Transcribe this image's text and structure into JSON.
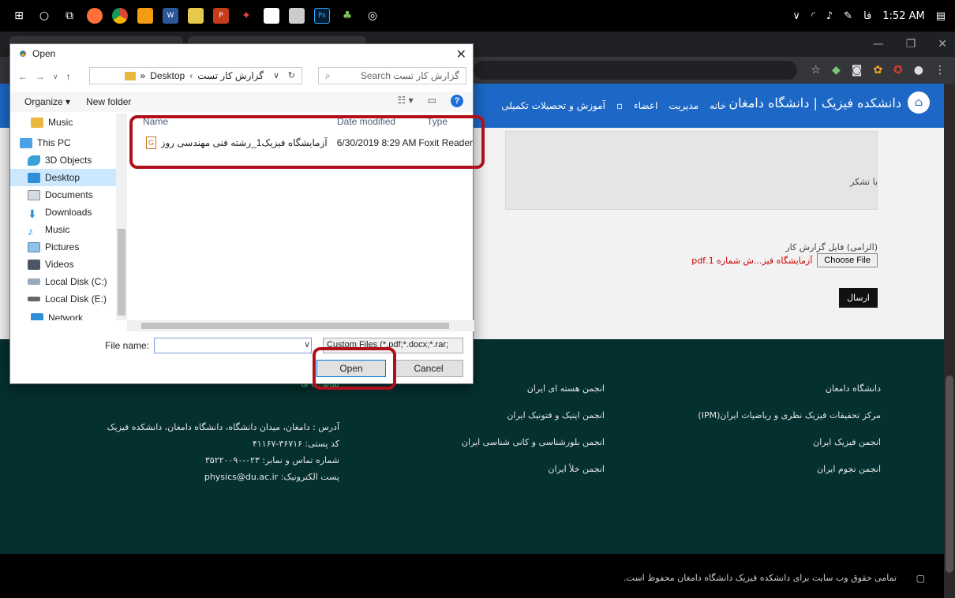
{
  "taskbar": {
    "apps": [
      "windows-icon",
      "search-icon",
      "task-view-icon",
      "firefox-icon",
      "chrome-icon",
      "edge-icon",
      "word-icon",
      "notepad-icon",
      "powerpoint-icon",
      "app-icon",
      "note-icon",
      "calculator-icon",
      "photoshop-icon",
      "leaf-icon",
      "settings-icon"
    ],
    "lang": "فا",
    "time": "1:52 AM"
  },
  "dialog": {
    "title": "Open",
    "path_root": "Desktop",
    "path_prefix": "«",
    "path_folder": "گزارش کار تست",
    "search_placeholder": "گزارش کار تست Search",
    "organize": "Organize ▾",
    "new_folder": "New folder",
    "nav_items": [
      {
        "label": "Music",
        "icon": "music-folder-icon"
      },
      {
        "label": "This PC",
        "icon": "pc-icon"
      },
      {
        "label": "3D Objects",
        "icon": "3d-objects-icon"
      },
      {
        "label": "Desktop",
        "icon": "desktop-icon"
      },
      {
        "label": "Documents",
        "icon": "documents-icon"
      },
      {
        "label": "Downloads",
        "icon": "downloads-icon"
      },
      {
        "label": "Music",
        "icon": "music-icon"
      },
      {
        "label": "Pictures",
        "icon": "pictures-icon"
      },
      {
        "label": "Videos",
        "icon": "videos-icon"
      },
      {
        "label": "Local Disk (C:)",
        "icon": "drive-c-icon"
      },
      {
        "label": "Local Disk (E:)",
        "icon": "drive-e-icon"
      },
      {
        "label": "Network",
        "icon": "network-icon"
      }
    ],
    "columns": {
      "name": "Name",
      "date": "Date modified",
      "type": "Type"
    },
    "file": {
      "name": "آزمایشگاه فیزیک1_رشته فنی مهندسی روز ش...",
      "date": "6/30/2019 8:29 AM",
      "type": "Foxit Reader"
    },
    "filename_label": "File name:",
    "filename_value": "",
    "filter": "Custom Files (*.pdf;*.docx;*.rar;",
    "open_label": "Open",
    "cancel_label": "Cancel"
  },
  "site": {
    "logo_text": "دانشکده فیزیک | دانشگاه دامغان",
    "menu": [
      "خانه",
      "مدیریت",
      "اعضاء",
      "آموزش و تحصیلات تکمیلی"
    ],
    "thanks": "با تشکر",
    "file_label": "(الزامی) فایل گزارش کار",
    "choose_file": "Choose File",
    "chosen_file": "آزمایشگاه فیز...ش شماره 1.pdf",
    "send": "ارسال"
  },
  "footer": {
    "col1": [
      "دانشگاه دامغان",
      "مرکز تحقیقات فیزیک نظری و ریاضیات ایران(IPM)",
      "انجمن فیزیک ایران",
      "انجمن نجوم ایران"
    ],
    "col2": [
      "انجمن هسته ای ایران",
      "انجمن اپتیک و فتونیک ایران",
      "انجمن بلورشناسی و کانی شناسی ایران",
      "انجمن خلأ ایران"
    ],
    "contact_title": "تماس با ما",
    "contact": [
      "آدرس : دامغان، میدان دانشگاه، دانشگاه دامغان، دانشکده فیزیک",
      "کد پستی: ۳۶۷۱۶-۴۱۱۶۷",
      "شماره تماس و نمابر: ۰۲۳-۳۵۲۲۰۰۹۰",
      "پست الکترونیک: physics@du.ac.ir"
    ],
    "copyright": "تمامی حقوق وب سایت برای دانشکده فیزیک دانشگاه دامغان محفوظ است."
  },
  "colors": {
    "nav_blue": "#1d68c7",
    "footer_teal": "#053030",
    "highlight_red": "#b0101c"
  }
}
